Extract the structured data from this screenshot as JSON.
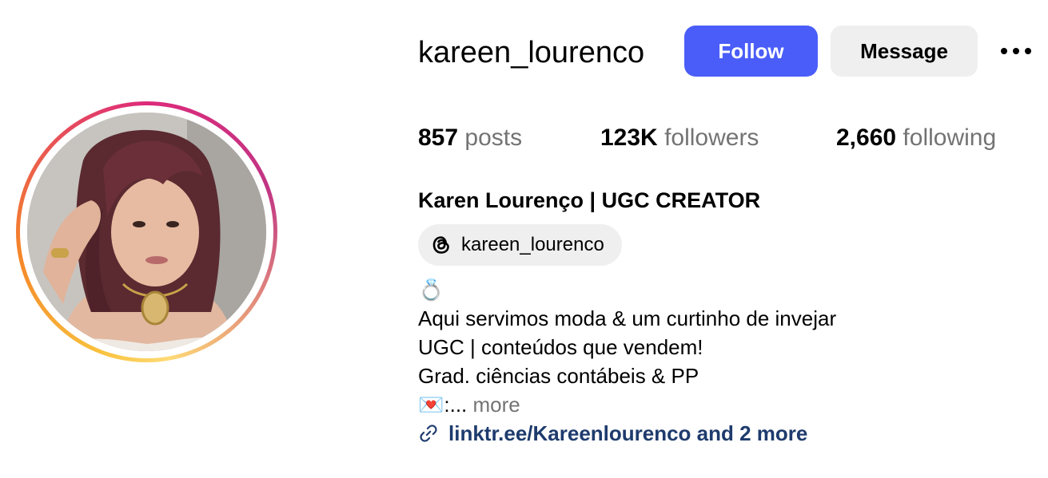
{
  "profile": {
    "username": "kareen_lourenco",
    "full_name": "Karen Lourenço | UGC CREATOR",
    "threads_handle": "kareen_lourenco"
  },
  "actions": {
    "follow_label": "Follow",
    "message_label": "Message",
    "more_icon": "more-horizontal-icon"
  },
  "stats": {
    "posts": {
      "value": "857",
      "label": "posts"
    },
    "followers": {
      "value": "123K",
      "label": "followers"
    },
    "following": {
      "value": "2,660",
      "label": "following"
    }
  },
  "bio": {
    "emoji_line": "💍",
    "lines": [
      "Aqui servimos moda & um curtinho de invejar",
      "UGC | conteúdos que vendem!",
      "Grad. ciências contábeis & PP"
    ],
    "truncated_prefix": "💌:...",
    "more_label": "more"
  },
  "link": {
    "text": "linktr.ee/Kareenlourenco and 2 more",
    "icon": "link-icon"
  },
  "colors": {
    "follow_button": "#4a5df9",
    "secondary_button": "#efefef",
    "link_text": "#1e3b6d",
    "muted_text": "#737373"
  }
}
